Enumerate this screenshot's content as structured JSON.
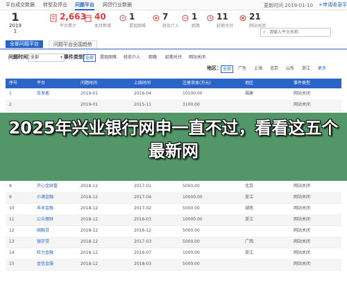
{
  "top_tabs": [
    "平台成交数据",
    "转型及停业",
    "问题平台",
    "网贷行业数据"
  ],
  "update_label": "更新时间 2019-01-10",
  "apply_link": "+申请收录平台",
  "date": {
    "day": "1",
    "year": "2019",
    "month": "1"
  },
  "stats": [
    {
      "num": "1",
      "label": "平台数",
      "color": "#333333",
      "icon": "doc-icon"
    },
    {
      "num": "2,663",
      "label": "平台累计",
      "color": "#e03c3c",
      "icon": "money-icon"
    },
    {
      "num": "40",
      "label": "本月新增",
      "color": "#e03c3c",
      "icon": "calendar-icon"
    },
    {
      "num": "1",
      "label": "提现困难",
      "color": "#333333",
      "icon": "alert-icon"
    },
    {
      "num": "7",
      "label": "经侦介入",
      "color": "#333333",
      "icon": "police-icon"
    },
    {
      "num": "1",
      "label": "跑路",
      "color": "#333333",
      "icon": "run-icon"
    },
    {
      "num": "11",
      "label": "延期兑付",
      "color": "#333333",
      "icon": "clock-icon"
    },
    {
      "num": "21",
      "label": "网站关闭",
      "color": "#333333",
      "icon": "close-icon"
    }
  ],
  "search": {
    "placeholder": "请输入平台名称"
  },
  "subtabs": [
    "全部问题平台",
    "问题平台全国趋势"
  ],
  "filters": {
    "time_label": "问题时间：",
    "time_value": "全部",
    "event_label": "事件类型：",
    "event_tags": [
      "全部",
      "提现困难",
      "经侦介入",
      "跑路",
      "延期兑付",
      "网站关闭"
    ],
    "region_label": "地区：",
    "region_tags": [
      "全部",
      "广东",
      "上海",
      "北京",
      "山东",
      "浙江"
    ],
    "more": "更多"
  },
  "table": {
    "headers": [
      "序号",
      "平台",
      "问题时间",
      "上线时间",
      "注册资本(万元)",
      "地区",
      "事件类型"
    ],
    "rows": [
      [
        "1",
        "百发客",
        "2019-01",
        "2016-04",
        "10100.00",
        "福建",
        "网站关闭"
      ],
      [
        "2",
        "",
        "2019-01",
        "2015-11",
        "3100.00",
        "",
        "网站关闭"
      ],
      [
        "8",
        "开心金财富",
        "2018-12",
        "2017-01",
        "5000.00",
        "北京",
        "网站关闭"
      ],
      [
        "9",
        "小满金融",
        "2018-12",
        "2017-04",
        "10000.00",
        "浙江",
        "网站关闭"
      ],
      [
        "10",
        "丰丰金融",
        "2018-12",
        "2017-02",
        "5000.00",
        "湖南",
        "网站关闭"
      ],
      [
        "11",
        "公众理财",
        "2018-12",
        "2016-03",
        "10000.00",
        "浙江",
        "网站关闭"
      ],
      [
        "12",
        "国融贷",
        "2018-12",
        "2016-12",
        "5000.00",
        "",
        "网站关闭"
      ],
      [
        "13",
        "银宇贷",
        "2018-12",
        "2017-03",
        "5000.00",
        "广西",
        "网站关闭"
      ],
      [
        "14",
        "旺力金融",
        "2018-12",
        "2016-07",
        "1000.00",
        "浙江",
        "网站关闭"
      ],
      [
        "15",
        "金信金服",
        "2018-12",
        "2018-03",
        "5000.00",
        "",
        "网站关闭"
      ]
    ]
  },
  "headline": "2025年兴业银行网申一直不过，看看这五个最新网"
}
